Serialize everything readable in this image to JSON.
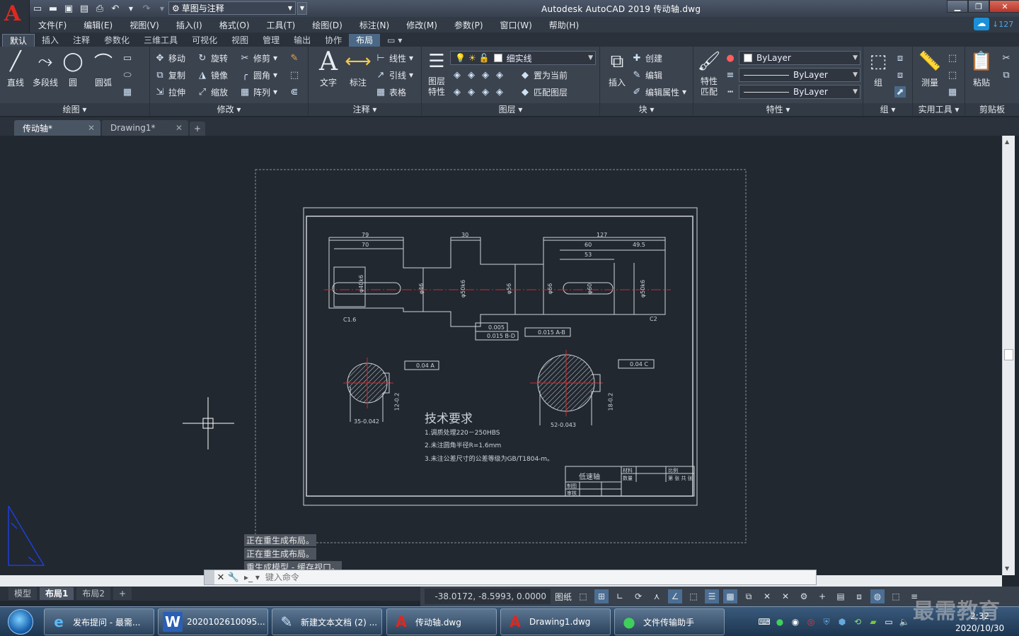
{
  "app": {
    "title": "Autodesk AutoCAD 2019    传动轴.dwg",
    "workspace": "草图与注释",
    "cloud_count": "127"
  },
  "menu": [
    "文件(F)",
    "编辑(E)",
    "视图(V)",
    "插入(I)",
    "格式(O)",
    "工具(T)",
    "绘图(D)",
    "标注(N)",
    "修改(M)",
    "参数(P)",
    "窗口(W)",
    "帮助(H)"
  ],
  "ribbon_tabs": [
    "默认",
    "插入",
    "注释",
    "参数化",
    "三维工具",
    "可视化",
    "视图",
    "管理",
    "输出",
    "协作",
    "布局"
  ],
  "ribbon": {
    "draw": {
      "title": "绘图",
      "line": "直线",
      "polyline": "多段线",
      "circle": "圆",
      "arc": "圆弧"
    },
    "modify": {
      "title": "修改",
      "move": "移动",
      "rotate": "旋转",
      "trim": "修剪",
      "copy": "复制",
      "mirror": "镜像",
      "fillet": "圆角",
      "stretch": "拉伸",
      "scale": "缩放",
      "array": "阵列"
    },
    "annotation": {
      "title": "注释",
      "text": "文字",
      "dimension": "标注",
      "linear": "线性",
      "leader": "引线",
      "table": "表格"
    },
    "layers": {
      "title": "图层",
      "layer_props": "图层特性",
      "current_layer": "细实线",
      "set_current": "置为当前",
      "match_layer": "匹配图层"
    },
    "block": {
      "title": "块",
      "insert": "插入",
      "create": "创建",
      "edit": "编辑",
      "edit_attr": "编辑属性"
    },
    "properties": {
      "title": "特性",
      "match": "特性匹配",
      "color": "ByLayer",
      "linetype": "ByLayer",
      "lineweight": "ByLayer"
    },
    "groups": {
      "title": "组",
      "group": "组"
    },
    "utilities": {
      "title": "实用工具",
      "measure": "测量"
    },
    "clipboard": {
      "title": "剪贴板",
      "paste": "粘贴"
    }
  },
  "doc_tabs": [
    "传动轴*",
    "Drawing1*"
  ],
  "drawing": {
    "dims_top": [
      "79",
      "70",
      "30",
      "127",
      "60",
      "49.5",
      "53"
    ],
    "dia_labels": [
      "φ40k6",
      "φ46",
      "φ50k6",
      "φ56",
      "φ66",
      "φ60",
      "φ50k6"
    ],
    "tolerances": [
      "0.005",
      "0.015 B-D",
      "0.015 A-B",
      "0.04 A",
      "0.04 C"
    ],
    "chamfers": [
      "C1.6",
      "C2"
    ],
    "tech_title": "技术要求",
    "tech_items": [
      "1.调质处理220－250HBS",
      "2.未注圆角半径R=1.6mm",
      "3.未注公差尺寸的公差等级为GB/T1804-m。"
    ],
    "section_dims": [
      "12-0.2",
      "35-0.042",
      "18-0.2",
      "52-0.043"
    ],
    "title_block": {
      "name": "低速轴",
      "material": "材料",
      "quantity": "数量",
      "ratio": "比例",
      "drawn": "制图",
      "review": "审核",
      "sheet": "第 张 共 张"
    }
  },
  "command": {
    "history": [
      "正在重生成布局。",
      "正在重生成布局。",
      "重生成模型 - 缓存视口。"
    ],
    "placeholder": "键入命令"
  },
  "layout_tabs": [
    "模型",
    "布局1",
    "布局2"
  ],
  "status": {
    "coords": "-38.0172, -8.5993, 0.0000",
    "paper": "图纸"
  },
  "taskbar": [
    {
      "label": "发布提问 - 最需...",
      "icon": "ie-icon"
    },
    {
      "label": "2020102610095...",
      "icon": "word-icon"
    },
    {
      "label": "新建文本文档 (2) ...",
      "icon": "notepad-icon"
    },
    {
      "label": "传动轴.dwg",
      "icon": "autocad-icon"
    },
    {
      "label": "Drawing1.dwg",
      "icon": "autocad-icon"
    },
    {
      "label": "文件传输助手",
      "icon": "wechat-icon"
    }
  ],
  "clock": {
    "time": "2:32",
    "date": "2020/10/30"
  },
  "watermark": "最需教育",
  "colors": {
    "canvas": "#212830",
    "ribbon": "#3b434f",
    "accent": "#4b6986",
    "center_line": "#d8232a"
  }
}
